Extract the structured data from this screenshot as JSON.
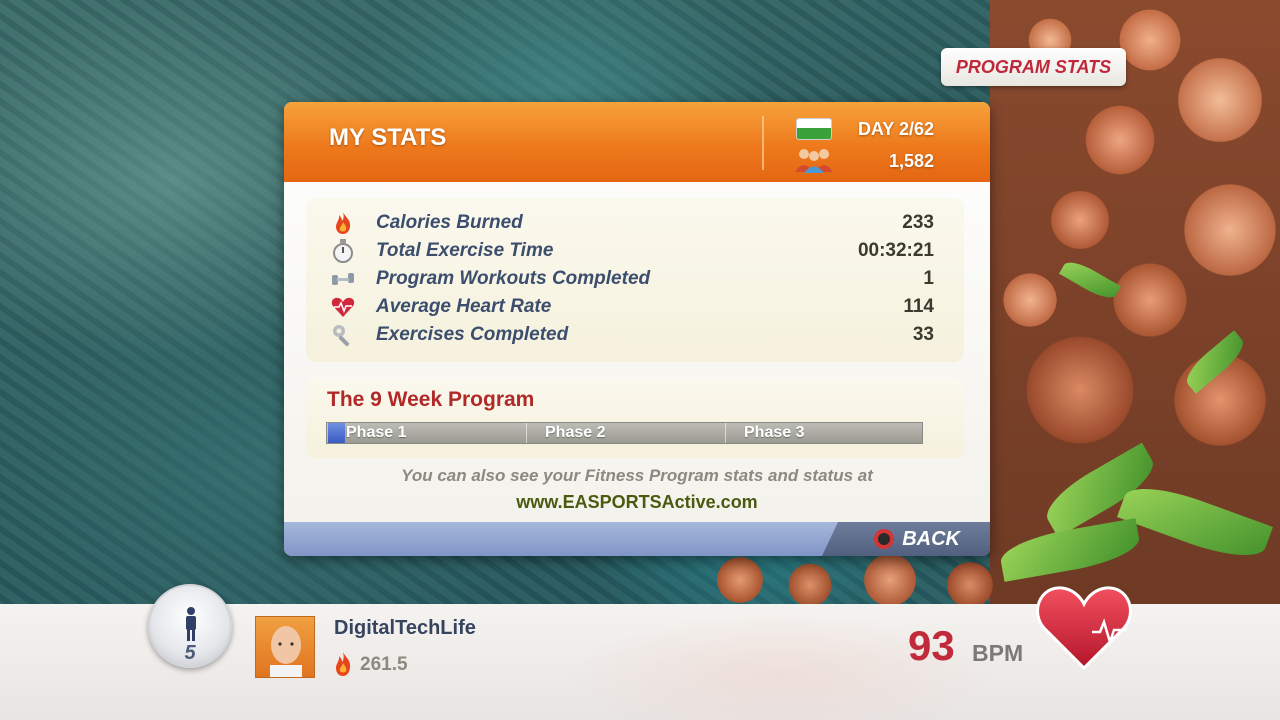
{
  "program_stats_tab": {
    "label": "PROGRAM STATS"
  },
  "panel": {
    "title": "MY STATS",
    "day": "DAY 2/62",
    "points": "1,582",
    "stats": [
      {
        "icon": "flame-icon",
        "label": "Calories Burned",
        "value": "233"
      },
      {
        "icon": "stopwatch-icon",
        "label": "Total Exercise Time",
        "value": "00:32:21"
      },
      {
        "icon": "dumbbell-icon",
        "label": "Program Workouts Completed",
        "value": "1"
      },
      {
        "icon": "heart-rate-icon",
        "label": "Average Heart Rate",
        "value": "114"
      },
      {
        "icon": "wrench-icon",
        "label": "Exercises Completed",
        "value": "33"
      }
    ],
    "program": {
      "title": "The 9 Week Program",
      "phases": [
        "Phase 1",
        "Phase 2",
        "Phase 3"
      ],
      "progress_fraction": 0.03
    },
    "info_text": "You can also see your Fitness Program stats and status at",
    "info_url": "www.EASPORTSActive.com",
    "back_label": "BACK"
  },
  "player": {
    "dial_number": "5",
    "username": "DigitalTechLife",
    "calories": "261.5"
  },
  "heart": {
    "bpm": "93",
    "unit": "BPM"
  },
  "colors": {
    "header_orange": "#ee7a1d",
    "accent_red": "#c02a3a",
    "label_blue": "#3c4e6e",
    "phase_fill_blue": "#3a5bc4"
  }
}
